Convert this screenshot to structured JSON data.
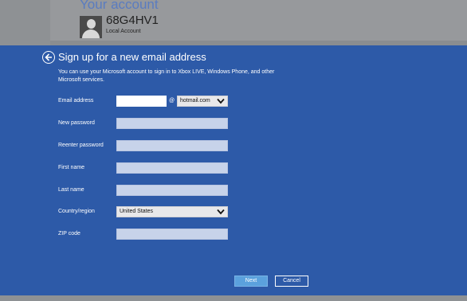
{
  "account": {
    "section_title": "Your account",
    "name": "68G4HV1",
    "type": "Local Account"
  },
  "dialog": {
    "title": "Sign up for a new email address",
    "description": "You can use your Microsoft account to sign in to Xbox LIVE, Windows Phone, and other Microsoft services."
  },
  "form": {
    "email_label": "Email address",
    "email_value": "",
    "at_symbol": "@",
    "domain_selected": "hotmail.com",
    "new_password_label": "New password",
    "reenter_password_label": "Reenter password",
    "first_name_label": "First name",
    "last_name_label": "Last name",
    "country_label": "Country/region",
    "country_selected": "United States",
    "zip_label": "ZIP code"
  },
  "buttons": {
    "next": "Next",
    "cancel": "Cancel"
  },
  "colors": {
    "background": "#2d5aa8",
    "field": "#c7d3ea",
    "next_button": "#5ba1dd"
  }
}
